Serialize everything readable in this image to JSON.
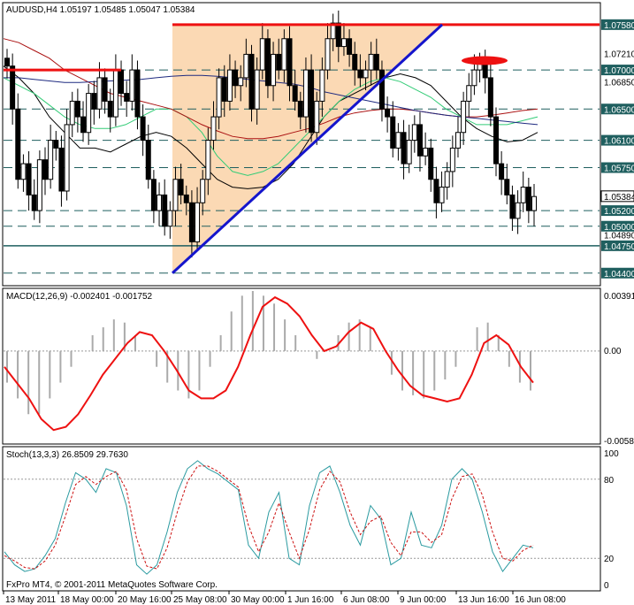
{
  "colors": {
    "up": "#000000",
    "down": "#000000",
    "bg": "#ffffff",
    "grid": "#1f5f5f",
    "red": "#ee1111",
    "blue": "#1515cc",
    "green": "#33cc77",
    "navy": "#1e2a80",
    "maroon": "#aa1111",
    "triangle_fill": "#fbd9b4",
    "price_box": "#1f5f5f"
  },
  "chart_data": [
    {
      "type": "candlestick",
      "title": "AUDUSD,H4  1.05197 1.05485 1.05047 1.05384",
      "symbol": "AUDUSD,H4",
      "ohlc_last": [
        1.05197,
        1.05485,
        1.05047,
        1.05384
      ],
      "ylim": [
        1.0425,
        1.0785
      ],
      "price_labels": [
        "1.07580",
        "1.07210",
        "1.07000",
        "1.06850",
        "1.06500",
        "1.06100",
        "1.05750",
        "1.05384",
        "1.05200",
        "1.05000",
        "1.04890",
        "1.04750",
        "1.04400"
      ],
      "boxed_levels": [
        "1.07580",
        "1.07000",
        "1.06500",
        "1.06100",
        "1.05750",
        "1.05384",
        "1.05200",
        "1.05000",
        "1.04750",
        "1.04400"
      ],
      "dashed_levels": [
        1.07,
        1.065,
        1.061,
        1.0575,
        1.052,
        1.05,
        1.044
      ],
      "solid_level": 1.0475,
      "resistance_top": 1.0758,
      "left_resistance": 1.07,
      "trend_line": {
        "from_price": 1.044,
        "to_price": 1.0758
      },
      "x_labels": [
        "13 May 2011",
        "18 May 00:00",
        "20 May 16:00",
        "25 May 08:00",
        "30 May 00:00",
        "1 Jun 16:00",
        "6 Jun 08:00",
        "9 Jun 00:00",
        "13 Jun 16:00",
        "16 Jun 08:00"
      ],
      "closes": [
        1.0705,
        1.065,
        1.056,
        1.058,
        1.054,
        1.052,
        1.0585,
        1.056,
        1.061,
        1.06,
        1.0545,
        1.063,
        1.066,
        1.064,
        1.062,
        1.067,
        1.065,
        1.069,
        1.066,
        1.064,
        1.07,
        1.067,
        1.066,
        1.07,
        1.064,
        1.061,
        1.056,
        1.052,
        1.054,
        1.05,
        1.052,
        1.056,
        1.054,
        1.053,
        1.048,
        1.053,
        1.056,
        1.061,
        1.064,
        1.069,
        1.066,
        1.07,
        1.068,
        1.069,
        1.072,
        1.065,
        1.07,
        1.074,
        1.068,
        1.072,
        1.07,
        1.074,
        1.068,
        1.066,
        1.064,
        1.07,
        1.062,
        1.066,
        1.07,
        1.074,
        1.076,
        1.073,
        1.074,
        1.072,
        1.07,
        1.069,
        1.07,
        1.072,
        1.07,
        1.065,
        1.064,
        1.06,
        1.062,
        1.058,
        1.061,
        1.063,
        1.059,
        1.06,
        1.056,
        1.053,
        1.055,
        1.057,
        1.06,
        1.062,
        1.066,
        1.068,
        1.07,
        1.071,
        1.069,
        1.064,
        1.058,
        1.056,
        1.054,
        1.051,
        1.053,
        1.055,
        1.052,
        1.0538
      ],
      "ma_series": [
        {
          "color": "black",
          "values": [
            1.0705,
            1.069,
            1.067,
            1.064,
            1.062,
            1.06,
            1.06,
            1.0595,
            1.0605,
            1.0615,
            1.062,
            1.0615,
            1.06,
            1.058,
            1.056,
            1.055,
            1.0548,
            1.055,
            1.056,
            1.058,
            1.061,
            1.064,
            1.066,
            1.067,
            1.068,
            1.069,
            1.0695,
            1.069,
            1.068,
            1.066,
            1.064,
            1.0625,
            1.0615,
            1.0608,
            1.061,
            1.062
          ]
        },
        {
          "color": "green",
          "values": [
            1.069,
            1.068,
            1.067,
            1.0655,
            1.064,
            1.063,
            1.0625,
            1.0625,
            1.063,
            1.064,
            1.065,
            1.065,
            1.064,
            1.062,
            1.059,
            1.057,
            1.0565,
            1.057,
            1.058,
            1.06,
            1.062,
            1.064,
            1.066,
            1.0675,
            1.0685,
            1.069,
            1.0685,
            1.0675,
            1.0665,
            1.065,
            1.064,
            1.063,
            1.063,
            1.063,
            1.0635,
            1.064
          ]
        },
        {
          "color": "maroon",
          "values": [
            1.074,
            1.0735,
            1.0725,
            1.0715,
            1.07,
            1.069,
            1.068,
            1.067,
            1.0665,
            1.066,
            1.0655,
            1.065,
            1.064,
            1.063,
            1.0622,
            1.0615,
            1.0612,
            1.0612,
            1.0615,
            1.062,
            1.0625,
            1.0632,
            1.064,
            1.0645,
            1.0648,
            1.065,
            1.065,
            1.0648,
            1.0645,
            1.0642,
            1.064,
            1.064,
            1.0642,
            1.0645,
            1.0648,
            1.065
          ]
        },
        {
          "color": "navy",
          "values": [
            1.069,
            1.069,
            1.0688,
            1.0686,
            1.0684,
            1.0684,
            1.0685,
            1.0686,
            1.0687,
            1.0688,
            1.069,
            1.0692,
            1.0693,
            1.0693,
            1.0692,
            1.069,
            1.0688,
            1.0686,
            1.0684,
            1.0682,
            1.0678,
            1.0672,
            1.0668,
            1.0664,
            1.066,
            1.0656,
            1.0652,
            1.0648,
            1.0645,
            1.0642,
            1.064,
            1.0638,
            1.0636,
            1.0634,
            1.0632,
            1.063
          ]
        }
      ]
    },
    {
      "type": "bar+line",
      "title": "MACD(12,26,9) -0.002401 -0.001752",
      "ylim": [
        -0.00583,
        0.00391
      ],
      "tick_labels": [
        "0.00391",
        "0.00",
        "-0.00583"
      ],
      "histogram": [
        -0.002,
        -0.003,
        -0.004,
        -0.004,
        -0.003,
        -0.002,
        -0.001,
        0.0,
        0.001,
        0.0015,
        0.002,
        0.0018,
        0.001,
        0.0,
        -0.001,
        -0.002,
        -0.0025,
        -0.003,
        -0.0025,
        -0.001,
        0.001,
        0.0025,
        0.0035,
        0.0038,
        0.0035,
        0.003,
        0.002,
        0.001,
        0.0,
        -0.0005,
        0.0,
        0.001,
        0.0018,
        0.002,
        0.0015,
        0.0,
        -0.0015,
        -0.0025,
        -0.0028,
        -0.003,
        -0.0025,
        -0.0018,
        -0.001,
        0.0,
        0.0015,
        0.0018,
        0.001,
        -0.001,
        -0.002,
        -0.0025
      ],
      "signal": [
        -0.001,
        -0.002,
        -0.003,
        -0.0043,
        -0.005,
        -0.0048,
        -0.004,
        -0.0028,
        -0.0015,
        -0.0005,
        0.0005,
        0.0012,
        0.001,
        0.0,
        -0.0012,
        -0.0025,
        -0.003,
        -0.003,
        -0.0025,
        -0.001,
        0.001,
        0.0028,
        0.0034,
        0.003,
        0.0022,
        0.001,
        0.0,
        0.0003,
        0.0012,
        0.0018,
        0.0014,
        0.0,
        -0.0012,
        -0.0022,
        -0.0028,
        -0.003,
        -0.0032,
        -0.003,
        -0.0015,
        0.0005,
        0.001,
        0.0004,
        -0.001,
        -0.002
      ]
    },
    {
      "type": "line",
      "title": "Stoch(13,3,3) 26.8509 29.7630",
      "ylim": [
        0,
        100
      ],
      "tick_labels": [
        "100",
        "80",
        "20",
        "0"
      ],
      "main": [
        25,
        15,
        10,
        12,
        22,
        35,
        62,
        85,
        80,
        70,
        88,
        85,
        60,
        15,
        8,
        15,
        40,
        70,
        88,
        94,
        88,
        84,
        78,
        72,
        30,
        20,
        55,
        70,
        20,
        15,
        60,
        85,
        90,
        70,
        45,
        30,
        60,
        50,
        15,
        20,
        55,
        30,
        28,
        45,
        80,
        88,
        80,
        55,
        25,
        10,
        20,
        30,
        28
      ],
      "signal": [
        22,
        18,
        13,
        12,
        18,
        30,
        52,
        76,
        82,
        76,
        82,
        86,
        72,
        35,
        14,
        12,
        28,
        55,
        78,
        90,
        90,
        86,
        80,
        74,
        45,
        25,
        40,
        62,
        40,
        20,
        42,
        72,
        86,
        78,
        55,
        38,
        48,
        52,
        32,
        22,
        40,
        40,
        32,
        38,
        65,
        82,
        84,
        68,
        40,
        20,
        18,
        26,
        30
      ]
    }
  ],
  "footer": {
    "copyright": "FxPro MT4, © 2001-2011 MetaQuotes Software Corp."
  }
}
